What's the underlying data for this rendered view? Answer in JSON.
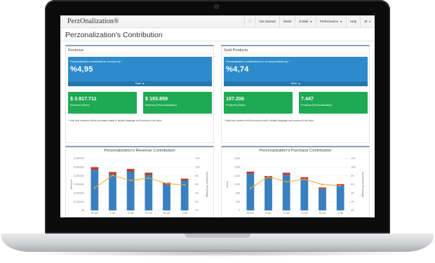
{
  "app": {
    "logo": "PerzOnalization®",
    "page_title": "Perzonalization's Contribution"
  },
  "nav": {
    "items": [
      {
        "label": "Get Started"
      },
      {
        "label": "Week"
      },
      {
        "label": "E-Mail",
        "dropdown": true
      },
      {
        "label": "Performance",
        "dropdown": true
      },
      {
        "label": "Help"
      }
    ],
    "home_icon": "home-icon",
    "settings_icon": "gear-icon"
  },
  "revenue": {
    "heading": "Revenue",
    "contribution_label": "Perzonalization contributed to revenue by *",
    "contribution_value": "%4,95",
    "more_label": "More ▲",
    "stat1": {
      "value": "$ 3.917.711",
      "label": "Revenue (Store)"
    },
    "stat2": {
      "value": "$ 193.859",
      "label": "Revenue (Perzonalization)"
    },
    "note": "* Note that numbers reflect purchases made in default language and curency of the store."
  },
  "products": {
    "heading": "Sold Products",
    "contribution_label": "Perzonalization contributed to # of sold products by *",
    "contribution_value": "%4,74",
    "more_label": "More ▲",
    "stat1": {
      "value": "157.206",
      "label": "Products (Store)"
    },
    "stat2": {
      "value": "7.447",
      "label": "Products (Perzonalization)"
    },
    "note": "* Note that numbers reflect products sold in default language and curency of the store."
  },
  "colors": {
    "blue": "#2d8bcb",
    "green": "#1daa52",
    "bar": "#3a80c0",
    "bar_top": "#c0392b",
    "line": "#f5a623"
  },
  "chart_data": [
    {
      "type": "bar",
      "title": "Perzonalization's Revenue Contribution",
      "categories": [
        "29.Dec",
        "5.Jan",
        "12.Jan",
        "19.Jan",
        "26.Jan",
        "2.Feb"
      ],
      "series": [
        {
          "values": [
            470000,
            415000,
            450000,
            410000,
            300000,
            345000
          ]
        },
        {
          "values": [
            30000,
            28000,
            29000,
            26000,
            20000,
            22000
          ]
        },
        {
          "values": [
            5.2,
            8.1,
            6.9,
            7.5,
            6.2,
            5.9
          ]
        }
      ],
      "ylabel": "Revenue",
      "y2label": "Contribution Percentage",
      "ylim": [
        0,
        600000
      ],
      "y2lim": [
        0,
        10
      ],
      "yticks": [
        "$0",
        "$ 100.000",
        "$ 200.000",
        "$ 300.000",
        "$ 400.000",
        "$ 500.000",
        "$ 600.000"
      ],
      "y2ticks": [
        "0%",
        "2%",
        "4%",
        "6%",
        "8%",
        "10%",
        "12%"
      ]
    },
    {
      "type": "bar",
      "title": "Perzonalization's Purchase Contribution",
      "categories": [
        "29.Dec",
        "5.Jan",
        "12.Jan",
        "19.Jan",
        "26.Jan",
        "2.Feb"
      ],
      "series": [
        {
          "values": [
            1700,
            1500,
            1650,
            1450,
            1000,
            1150
          ]
        },
        {
          "values": [
            95,
            90,
            92,
            85,
            60,
            65
          ]
        },
        {
          "values": [
            5.1,
            7.8,
            6.6,
            7.2,
            6.0,
            5.7
          ]
        }
      ],
      "ylabel": "Count",
      "y2label": "Contribution Percentage",
      "ylim": [
        0,
        2400
      ],
      "y2lim": [
        0,
        10
      ],
      "yticks": [
        "0",
        "400",
        "800",
        "1.200",
        "1.600",
        "2.000",
        "2.400"
      ],
      "y2ticks": [
        "0%",
        "2%",
        "4%",
        "6%",
        "8%",
        "10%",
        "12%"
      ]
    }
  ]
}
